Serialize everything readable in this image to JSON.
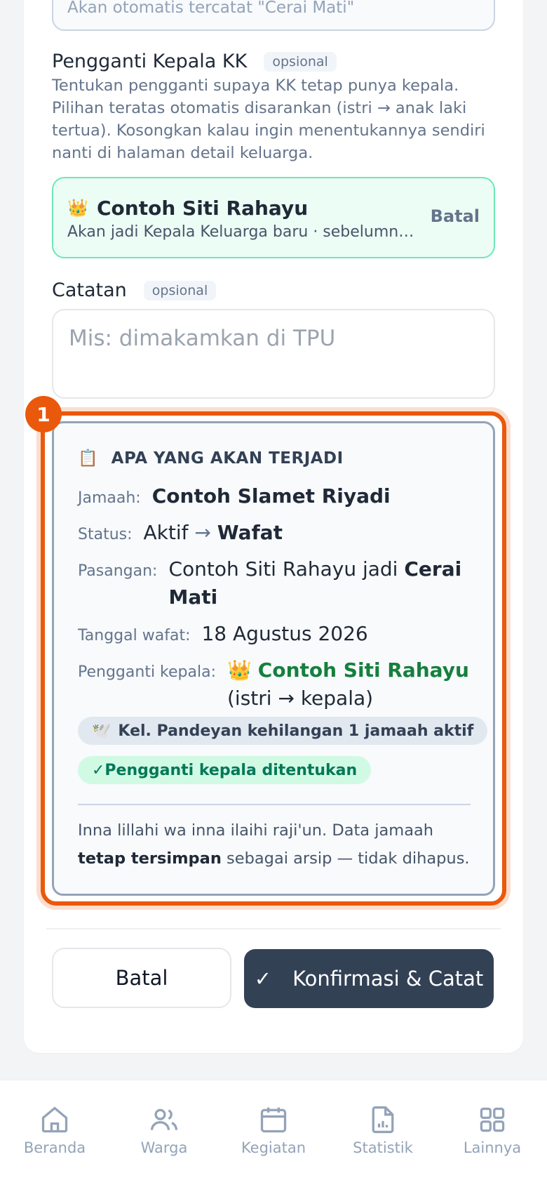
{
  "status_input": {
    "placeholder": "Akan otomatis tercatat \"Cerai Mati\""
  },
  "successor_section": {
    "label": "Pengganti Kepala KK",
    "optional_tag": "opsional",
    "help_text": "Tentukan pengganti supaya KK tetap punya kepala. Pilihan teratas otomatis disarankan (istri → anak laki tertua). Kosongkan kalau ingin menentukannya sendiri nanti di halaman detail keluarga.",
    "selected_icon": "👑",
    "selected_name": "Contoh Siti Rahayu",
    "selected_sub": "Akan jadi Kepala Keluarga baru · sebelumnya istri",
    "cancel_label": "Batal"
  },
  "notes_section": {
    "label": "Catatan",
    "optional_tag": "opsional",
    "placeholder": "Mis: dimakamkan di TPU"
  },
  "highlight_badge": "1",
  "summary": {
    "icon": "📋",
    "title": "APA YANG AKAN TERJADI",
    "jamaah_label": "Jamaah:",
    "jamaah_value": "Contoh Slamet Riyadi",
    "status_label": "Status:",
    "status_from": "Aktif",
    "status_arrow": "→",
    "status_to": "Wafat",
    "pasangan_label": "Pasangan:",
    "pasangan_prefix": "Contoh Siti Rahayu jadi",
    "pasangan_status": "Cerai Mati",
    "tanggal_label": "Tanggal wafat:",
    "tanggal_value": "18 Agustus 2026",
    "pengganti_label": "Pengganti kepala:",
    "pengganti_icon": "👑",
    "pengganti_name": "Contoh Siti Rahayu",
    "pengganti_note": "(istri → kepala)",
    "pill_loss_icon": "🕊️",
    "pill_loss": "Kel. Pandeyan kehilangan 1 jamaah aktif",
    "pill_success": "✓Pengganti kepala ditentukan",
    "footer_prefix": "Inna lillahi wa inna ilaihi raji'un. Data jamaah",
    "footer_bold": "tetap tersimpan",
    "footer_suffix": "sebagai arsip — tidak dihapus."
  },
  "actions": {
    "cancel_label": "Batal",
    "confirm_icon": "✓",
    "confirm_label": "Konfirmasi & Catat"
  },
  "bottom_nav": [
    {
      "label": "Beranda",
      "icon": "home-icon"
    },
    {
      "label": "Warga",
      "icon": "users-icon"
    },
    {
      "label": "Kegiatan",
      "icon": "calendar-icon"
    },
    {
      "label": "Statistik",
      "icon": "chart-icon"
    },
    {
      "label": "Lainnya",
      "icon": "grid-icon"
    }
  ],
  "colors": {
    "accent": "#334155",
    "highlight": "#ea580c",
    "success": "#15803d",
    "success_bg": "#ecfdf5"
  }
}
